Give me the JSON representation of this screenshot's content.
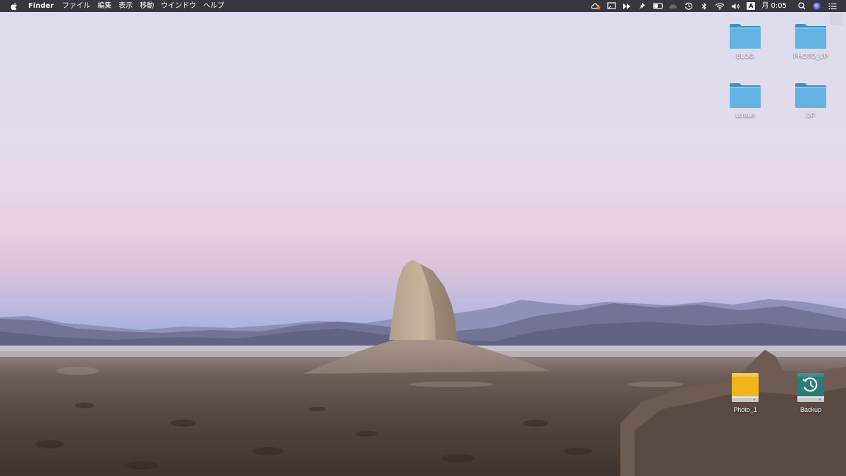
{
  "menubar": {
    "app_name": "Finder",
    "menus": [
      "ファイル",
      "編集",
      "表示",
      "移動",
      "ウインドウ",
      "ヘルプ"
    ],
    "clock": "月 0:05",
    "input_mode": "A",
    "status_icons": [
      "creative-cloud-icon",
      "airplay-display-icon",
      "fast-forward-icon",
      "pin-icon",
      "toggle-icon",
      "cloud-icon",
      "time-machine-icon",
      "bluetooth-icon",
      "wifi-icon",
      "volume-icon",
      "input-method-icon",
      "spotlight-search-icon",
      "siri-icon",
      "notification-center-icon"
    ]
  },
  "desktop": {
    "folders": [
      {
        "label": "BLOG"
      },
      {
        "label": "PHOTO_UP"
      },
      {
        "label": "screen"
      },
      {
        "label": "UP"
      }
    ],
    "drives": [
      {
        "label": "Photo_1",
        "type": "external-drive"
      },
      {
        "label": "Backup",
        "type": "time-machine-drive"
      }
    ]
  },
  "colors": {
    "folder_blue": "#5aa9d8",
    "drive_yellow": "#f0b41c",
    "backup_teal": "#2c7a74",
    "menubar_bg": "#282830"
  }
}
